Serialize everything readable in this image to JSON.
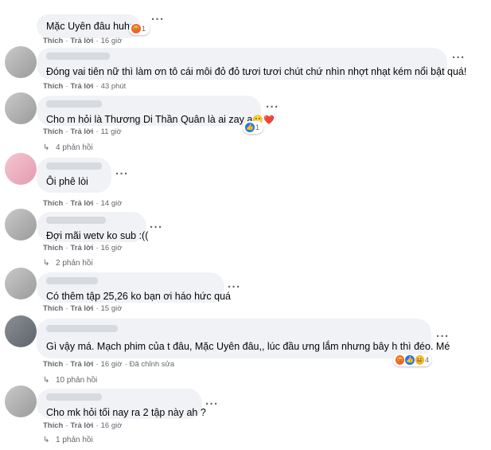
{
  "comments": [
    {
      "text": "Mặc Uyên đâu huhu",
      "like": "Thích",
      "reply": "Trả lời",
      "time": "16 giờ",
      "reactions": {
        "count": "1"
      }
    },
    {
      "text": "Đóng vai tiên nữ thì làm ơn tô cái môi đỏ đỏ tươi tươi chút chứ nhìn nhợt nhạt kém nổi bật quá!",
      "like": "Thích",
      "reply": "Trả lời",
      "time": "43 phút"
    },
    {
      "text": "Cho m hỏi là Thương Di Thần Quân là ai zay ạ",
      "emoji": "😁❤️",
      "like": "Thích",
      "reply": "Trả lời",
      "time": "11 giờ",
      "reactions": {
        "count": "1"
      },
      "replies": "4 phản hồi"
    },
    {
      "text": "Ôi phê lòi",
      "like": "Thích",
      "reply": "Trả lời",
      "time": "14 giờ"
    },
    {
      "text": "Đợi mãi wetv ko sub :((",
      "like": "Thích",
      "reply": "Trả lời",
      "time": "16 giờ",
      "replies": "2 phản hồi"
    },
    {
      "text": "Có thêm tập 25,26 ko bạn ơi háo hức quá",
      "like": "Thích",
      "reply": "Trả lời",
      "time": "15 giờ"
    },
    {
      "text": "Gì vậy má. Mạch phim của t đâu, Mặc Uyên đâu,, lúc đầu ưng lắm nhưng bây h thì đéo. Mé",
      "like": "Thích",
      "reply": "Trả lời",
      "time": "16 giờ",
      "edited": "Đã chỉnh sửa",
      "reactions": {
        "count": "4"
      },
      "replies": "10 phản hồi"
    },
    {
      "text": "Cho mk hỏi tối nay ra 2 tập này ah ?",
      "like": "Thích",
      "reply": "Trả lời",
      "time": "16 giờ",
      "replies": "1 phản hồi"
    }
  ],
  "icons": {
    "reply_arrow": "reply-arrow-icon",
    "more": "more-options-icon",
    "angry": "angry-reaction-icon",
    "like": "like-reaction-icon",
    "haha": "haha-reaction-icon",
    "love": "love-reaction-icon"
  },
  "colors": {
    "bubble": "#f0f2f5",
    "meta": "#65676b",
    "like_blue": "#1877f2",
    "angry": "#f0633b"
  }
}
